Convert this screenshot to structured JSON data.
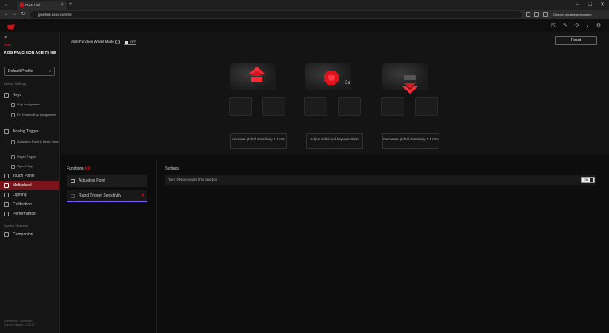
{
  "browser": {
    "tab_title": "Gear Link",
    "url": "gearlink.asus.com/en",
    "language_prompt": "Окно в режиме инкогнито"
  },
  "app": {
    "brand": "ROG",
    "device_name": "ROG FALCHION ACE 75 HE",
    "profile": "Default Profile",
    "reset_label": "Reset",
    "mfw_label": "Multi-Function Wheel Mode",
    "mfw_toggle": "OFF"
  },
  "sidebar": {
    "device_settings": "Device Settings",
    "keys": "Keys",
    "key_assignment": "Key Assignment",
    "fn_combo": "Fn Combo Key Assignment",
    "analog_trigger": "Analog Trigger",
    "actuation_dead_zone": "Actuation Point & Dead Zone",
    "rapid_trigger": "Rapid Trigger",
    "speed_tap": "Speed Tap",
    "touch_panel": "Touch Panel",
    "multiwheel": "Multiwheel",
    "lighting": "Lighting",
    "calibration": "Calibration",
    "performance": "Performance",
    "system_features": "System Features",
    "companion": "Companion",
    "footer_line1": "Connection : Bluetooth",
    "footer_line2": "Current Version : 1.00.07"
  },
  "wheel": {
    "increase_desc": "Increase global sensitivity 0.1 mm",
    "adjust_desc": "Adjust individual key sensitivity",
    "decrease_desc": "Decrease global sensitivity 0.1 mm",
    "hold_label": "3s"
  },
  "functions": {
    "title": "Functions",
    "badge": "2",
    "items": [
      {
        "label": "Actuation Point"
      },
      {
        "label": "Rapid Trigger Sensitivity",
        "count": "4"
      }
    ]
  },
  "settings": {
    "title": "Settings",
    "row_label": "Turn ON to enable this function",
    "toggle": "ON"
  },
  "colors": {
    "accent": "#e0141e",
    "active_nav": "#7a141a",
    "selected_underline": "#7b5cff"
  }
}
